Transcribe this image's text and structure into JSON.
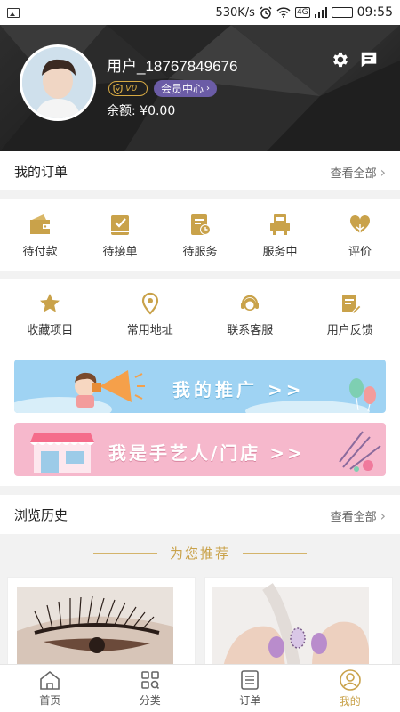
{
  "status_bar": {
    "speed": "530K/s",
    "network": "4G",
    "battery": "100",
    "time": "09:55"
  },
  "profile": {
    "username": "用户_18767849676",
    "level": "V0",
    "member_center": "会员中心",
    "balance_label": "余额:",
    "balance_value": "¥0.00"
  },
  "orders": {
    "title": "我的订单",
    "see_all": "查看全部",
    "items": [
      {
        "label": "待付款",
        "icon": "wallet-icon"
      },
      {
        "label": "待接单",
        "icon": "accept-order-icon"
      },
      {
        "label": "待服务",
        "icon": "pending-service-icon"
      },
      {
        "label": "服务中",
        "icon": "in-service-icon"
      },
      {
        "label": "评价",
        "icon": "review-icon"
      }
    ]
  },
  "tools": {
    "items": [
      {
        "label": "收藏项目",
        "icon": "star-icon"
      },
      {
        "label": "常用地址",
        "icon": "location-pin-icon"
      },
      {
        "label": "联系客服",
        "icon": "customer-service-icon"
      },
      {
        "label": "用户反馈",
        "icon": "feedback-icon"
      }
    ]
  },
  "banners": {
    "promote": "我的推广 >>",
    "artisan": "我是手艺人/门店 >>"
  },
  "history": {
    "title": "浏览历史",
    "see_all": "查看全部"
  },
  "recommend": {
    "title": "为您推荐"
  },
  "tabbar": {
    "items": [
      {
        "label": "首页",
        "icon": "home-icon"
      },
      {
        "label": "分类",
        "icon": "category-icon"
      },
      {
        "label": "订单",
        "icon": "order-list-icon"
      },
      {
        "label": "我的",
        "icon": "profile-icon",
        "active": true
      }
    ]
  },
  "colors": {
    "accent_gold": "#c9a24a",
    "member_purple": "#6b5ca6",
    "header_dark": "#222222",
    "banner_blue": "#9fd3f3",
    "banner_pink": "#f6b8cc"
  }
}
